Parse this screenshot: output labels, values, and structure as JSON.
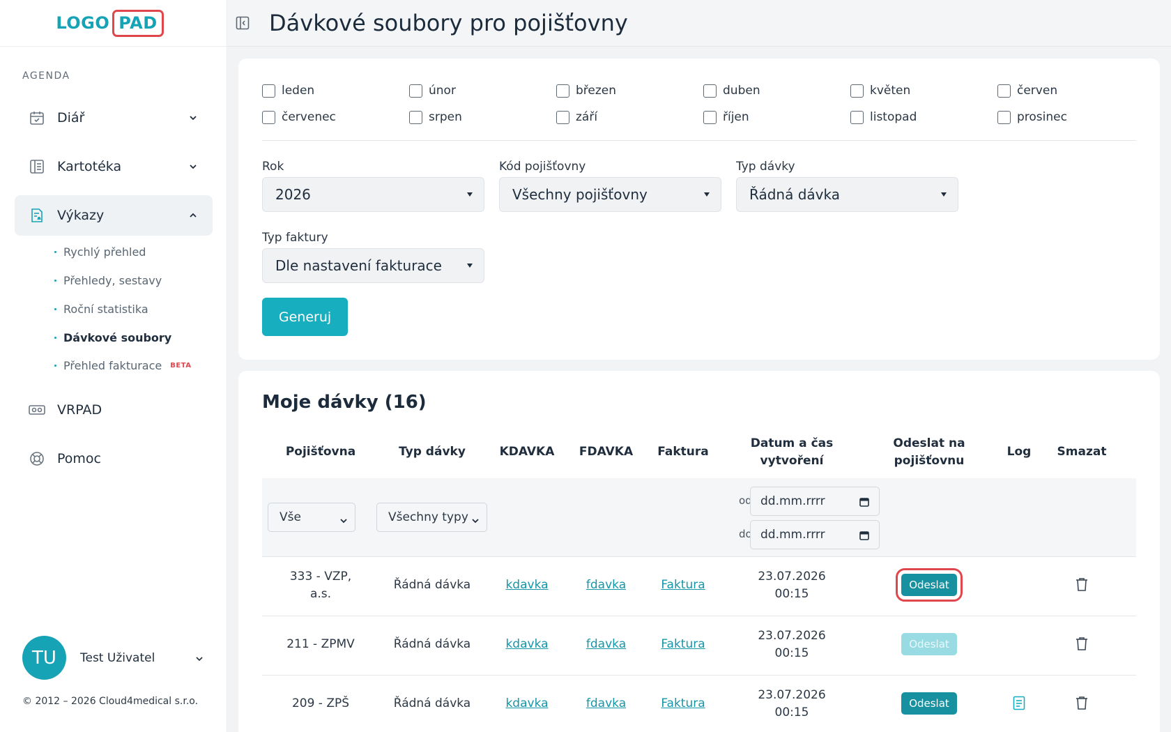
{
  "logo": {
    "part1": "LOGO",
    "part2": "PAD"
  },
  "sidebar": {
    "section_label": "AGENDA",
    "items": [
      {
        "label": "Diář"
      },
      {
        "label": "Kartotéka"
      },
      {
        "label": "Výkazy"
      },
      {
        "label": "VRPAD"
      },
      {
        "label": "Pomoc"
      }
    ],
    "subitems": [
      {
        "label": "Rychlý přehled"
      },
      {
        "label": "Přehledy, sestavy"
      },
      {
        "label": "Roční statistika"
      },
      {
        "label": "Dávkové soubory"
      },
      {
        "label": "Přehled fakturace",
        "badge": "BETA"
      }
    ],
    "user": {
      "initials": "TU",
      "name": "Test Uživatel"
    },
    "copyright": "© 2012 – 2026 Cloud4medical s.r.o."
  },
  "header": {
    "title": "Dávkové soubory pro pojišťovny"
  },
  "filters": {
    "months": [
      "leden",
      "únor",
      "březen",
      "duben",
      "květen",
      "červen",
      "červenec",
      "srpen",
      "září",
      "říjen",
      "listopad",
      "prosinec"
    ],
    "year": {
      "label": "Rok",
      "value": "2026"
    },
    "insurer": {
      "label": "Kód pojišťovny",
      "value": "Všechny pojišťovny"
    },
    "batch_type": {
      "label": "Typ dávky",
      "value": "Řádná dávka"
    },
    "invoice_type": {
      "label": "Typ faktury",
      "value": "Dle nastavení fakturace"
    },
    "generate_label": "Generuj"
  },
  "batches": {
    "title": "Moje dávky (16)",
    "columns": {
      "insurer": "Pojišťovna",
      "type": "Typ dávky",
      "kdavka": "KDAVKA",
      "fdavka": "FDAVKA",
      "invoice": "Faktura",
      "created_1": "Datum a čas",
      "created_2": "vytvoření",
      "send_1": "Odeslat na",
      "send_2": "pojišťovnu",
      "log": "Log",
      "delete": "Smazat"
    },
    "filter": {
      "insurer_value": "Vše",
      "type_value": "Všechny typy",
      "from_label": "od",
      "to_label": "do",
      "date_placeholder": "dd.mm.rrrr"
    },
    "rows": [
      {
        "insurer_1": "333 - VZP,",
        "insurer_2": "a.s.",
        "type": "Řádná dávka",
        "kdavka": "kdavka",
        "fdavka": "fdavka",
        "invoice": "Faktura",
        "date": "23.07.2026",
        "time": "00:15",
        "send": "Odeslat"
      },
      {
        "insurer_1": "211 - ZPMV",
        "insurer_2": "",
        "type": "Řádná dávka",
        "kdavka": "kdavka",
        "fdavka": "fdavka",
        "invoice": "Faktura",
        "date": "23.07.2026",
        "time": "00:15",
        "send": "Odeslat"
      },
      {
        "insurer_1": "209 - ZPŠ",
        "insurer_2": "",
        "type": "Řádná dávka",
        "kdavka": "kdavka",
        "fdavka": "fdavka",
        "invoice": "Faktura",
        "date": "23.07.2026",
        "time": "00:15",
        "send": "Odeslat"
      }
    ]
  },
  "colors": {
    "accent": "#16a3b6",
    "brand_red": "#e0474c",
    "send_active": "#17919f",
    "send_disabled": "#98dbe3"
  },
  "icons": [
    "calendar-icon",
    "files-icon",
    "report-icon",
    "vr-headset-icon",
    "lifebuoy-icon",
    "chevron-down-icon",
    "chevron-up-icon",
    "sidebar-collapse-icon",
    "trash-icon",
    "log-document-icon"
  ]
}
